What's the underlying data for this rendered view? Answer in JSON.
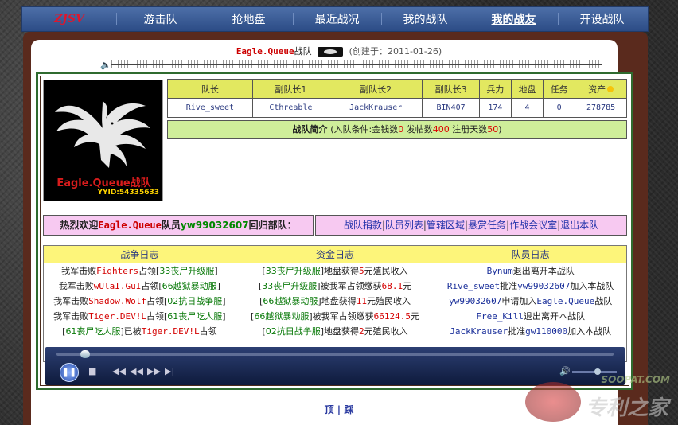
{
  "nav": {
    "logo": "ZJSV",
    "items": [
      "游击队",
      "抢地盘",
      "最近战况",
      "我的战队",
      "我的战友",
      "开设战队"
    ],
    "active_index": 4
  },
  "header": {
    "team_name": "Eagle.Queue",
    "suffix": "战队",
    "created": "(创建于：2011-01-26)"
  },
  "logo_card": {
    "name": "Eagle.Queue战队",
    "yyid": "YYID:54335633"
  },
  "stats": {
    "headers": [
      "队长",
      "副队长1",
      "副队长2",
      "副队长3",
      "兵力",
      "地盘",
      "任务",
      "资产"
    ],
    "values": [
      "Rive_sweet",
      "Cthreable",
      "JackKrauser",
      "BIN407",
      "174",
      "4",
      "0",
      "278785"
    ]
  },
  "intro": {
    "title": "战队简介",
    "cond_prefix": "(入队条件:金钱数",
    "money": "0",
    "posts_label": " 发帖数",
    "posts": "400",
    "days_label": " 注册天数",
    "days": "50",
    "cond_suffix": ")"
  },
  "welcome": {
    "prefix": "热烈欢迎",
    "team": "Eagle.Queue",
    "member_label": "队员",
    "member": "yw99032607",
    "suffix": "回归部队："
  },
  "links": [
    "战队捐款",
    "队员列表",
    "管辖区域",
    "悬赏任务",
    "作战会议室",
    "退出本队"
  ],
  "logs": {
    "headers": [
      "战争日志",
      "资金日志",
      "队员日志"
    ],
    "war": [
      [
        "我军击败",
        "Fighters",
        "占领[",
        "33丧尸升级服",
        "]"
      ],
      [
        "我军击败",
        "wUlaI.GuI",
        "占领[",
        "66越狱暴动服",
        "]"
      ],
      [
        "我军击败",
        "Shadow.Wolf",
        "占领[",
        "02抗日战争服",
        "]"
      ],
      [
        "我军击败",
        "Tiger.DEV!L",
        "占领[",
        "61丧尸吃人服",
        "]"
      ],
      [
        "[",
        "61丧尸吃人服",
        "]已被",
        "Tiger.DEV!L",
        "占领"
      ]
    ],
    "funds": [
      [
        "[",
        "33丧尸升级服",
        "]地盘获得",
        "5",
        "元殖民收入"
      ],
      [
        "[",
        "33丧尸升级服",
        "]被我军占领缴获",
        "68.1",
        "元"
      ],
      [
        "[",
        "66越狱暴动服",
        "]地盘获得",
        "11",
        "元殖民收入"
      ],
      [
        "[",
        "66越狱暴动服",
        "]被我军占领缴获",
        "66124.5",
        "元"
      ],
      [
        "[",
        "02抗日战争服",
        "]地盘获得",
        "2",
        "元殖民收入"
      ]
    ],
    "members": [
      [
        "Bynum",
        "退出离开本战队",
        "",
        ""
      ],
      [
        "Rive_sweet",
        "批准",
        "yw99032607",
        "加入本战队"
      ],
      [
        "yw99032607",
        "申请加入",
        "Eagle.Queue",
        "战队"
      ],
      [
        "Free_Kill",
        "退出离开本战队",
        "",
        ""
      ],
      [
        "JackKrauser",
        "批准",
        "gw110000",
        "加入本战队"
      ]
    ]
  },
  "footer": {
    "top": "顶",
    "sep": "|",
    "bottom": "踩"
  },
  "watermark": {
    "line1": "SOOPAT.COM",
    "line2": "专利之家"
  },
  "colors": {
    "nav_bg": "#3a5c97",
    "frame": "#5a2a1d",
    "border_green": "#2f6b2f",
    "header_yellow": "#e2e860",
    "intro_green": "#cfee9a",
    "pink": "#f7c9f1",
    "log_header": "#fdf57a"
  }
}
